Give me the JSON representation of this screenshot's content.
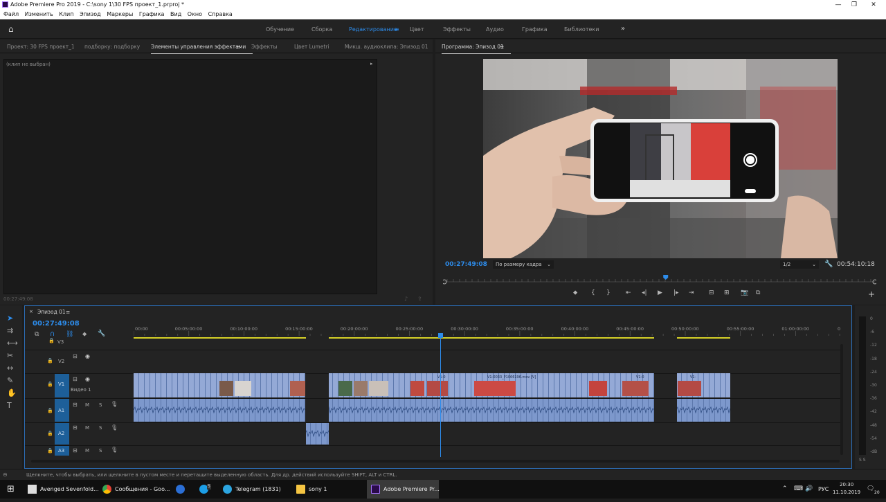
{
  "window": {
    "title": "Adobe Premiere Pro 2019 - C:\\sony 1\\30 FPS проект_1.prproj *"
  },
  "menu": [
    "Файл",
    "Изменить",
    "Клип",
    "Эпизод",
    "Маркеры",
    "Графика",
    "Вид",
    "Окно",
    "Справка"
  ],
  "workspaces": [
    "Обучение",
    "Сборка",
    "Редактирование",
    "Цвет",
    "Эффекты",
    "Аудио",
    "Графика",
    "Библиотеки"
  ],
  "workspace_active": "Редактирование",
  "left_tabs": [
    "Проект: 30 FPS проект_1",
    "подборку: подборку",
    "Элементы управления эффектами",
    "Эффекты",
    "Цвет Lumetri",
    "Микш. аудиоклипа: Эпизод 01"
  ],
  "effect_controls": {
    "no_clip": "(клип не выбран)",
    "timecode": "00:27:49:08"
  },
  "program": {
    "tab": "Программа: Эпизод 01",
    "timecode": "00:27:49:08",
    "fit": "По размеру кадра",
    "resolution": "1/2",
    "duration": "00:54:10:18",
    "playhead_fraction": 0.514
  },
  "timeline": {
    "tab": "Эпизод 01",
    "timecode": "00:27:49:08",
    "ruler": [
      "00:00",
      "00:05:00:00",
      "00:10:00:00",
      "00:15:00:00",
      "00:20:00:00",
      "00:25:00:00",
      "00:30:00:00",
      "00:35:00:00",
      "00:40:00:00",
      "00:45:00:00",
      "00:50:00:00",
      "00:55:00:00",
      "01:00:00:00",
      "0"
    ],
    "tracks": {
      "v3": "V3",
      "v2": "V2",
      "v1": "V1",
      "v1_label": "Видео 1",
      "a1": "A1",
      "a2": "A2",
      "a3": "A3",
      "m": "M",
      "s": "S"
    },
    "clip_labels": {
      "c1": "V1-0",
      "c2": "V1-0033_P1066196.mov [V]",
      "c3": "V1-0",
      "c4": "V1-"
    },
    "meter_scale": [
      "0",
      "-6",
      "-12",
      "-18",
      "-24",
      "-30",
      "-36",
      "-42",
      "-48",
      "-54",
      "-dB"
    ],
    "meter_ss": "S S"
  },
  "status": {
    "message": "Щелкните, чтобы выбрать, или щелкните в пустом месте и перетащите выделенную область. Для др. действий используйте SHIFT, ALT и CTRL."
  },
  "taskbar": {
    "items": [
      "Avenged Sevenfold...",
      "Сообщения - Goo...",
      "Telegram (1831)",
      "sony 1",
      "Adobe Premiere Pr..."
    ],
    "skype_badge": "5",
    "lang": "РУС",
    "time": "20:30",
    "date": "11.10.2019",
    "notif": "20"
  }
}
